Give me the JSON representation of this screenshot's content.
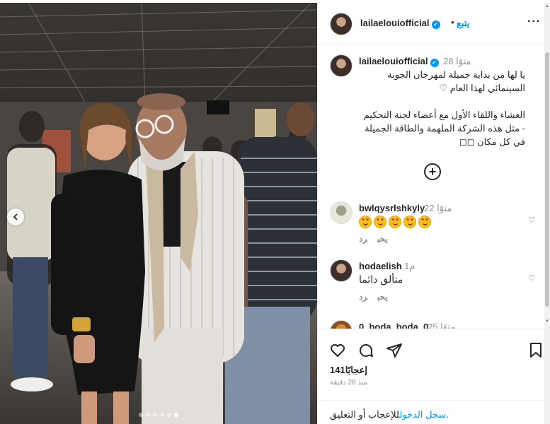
{
  "post": {
    "username": "lailaelouiofficial",
    "follow_label": "يتبع",
    "header_separator": "•",
    "more_label": "···",
    "caption_time": "28 متوًا",
    "caption_lines": [
      "يا لها من بداية جميلة لمهرجان الجونة",
      "السينمائي لهذا العام ♡",
      "العشاء واللقاء الأول مع أعضاء لجنة التحكيم",
      "- مثل هذه الشركة الملهمة والطاقة الجميلة",
      "في كل مكان ◻◻"
    ],
    "load_more_label": "+"
  },
  "comments": [
    {
      "username": "bwlqysrlshkyly",
      "time": "22 متوًا",
      "text": "",
      "emoji_count": 5,
      "reply_label": "رد",
      "like_label": "يحب"
    },
    {
      "username": "hodaelish",
      "time": "1م",
      "text": "متألق دائما",
      "reply_label": "رد",
      "like_label": "يحب"
    },
    {
      "username": "0_boda_boda_0",
      "time": "25 متوًا",
      "text": ""
    }
  ],
  "footer": {
    "likes": "141إعجابًا",
    "posted_time": "منذ 28 دقيقة",
    "login_link": "سجل الدخول",
    "login_text": "للإعجاب أو التعليق."
  },
  "carousel": {
    "total": 6,
    "active": 5
  },
  "icons": [
    "heart-icon",
    "comment-icon",
    "share-icon",
    "bookmark-icon",
    "chevron-left-icon",
    "plus-circle-icon",
    "verified-icon",
    "more-icon"
  ],
  "colors": {
    "accent": "#0095f6",
    "text": "#262626",
    "muted": "#8e8e8e"
  }
}
